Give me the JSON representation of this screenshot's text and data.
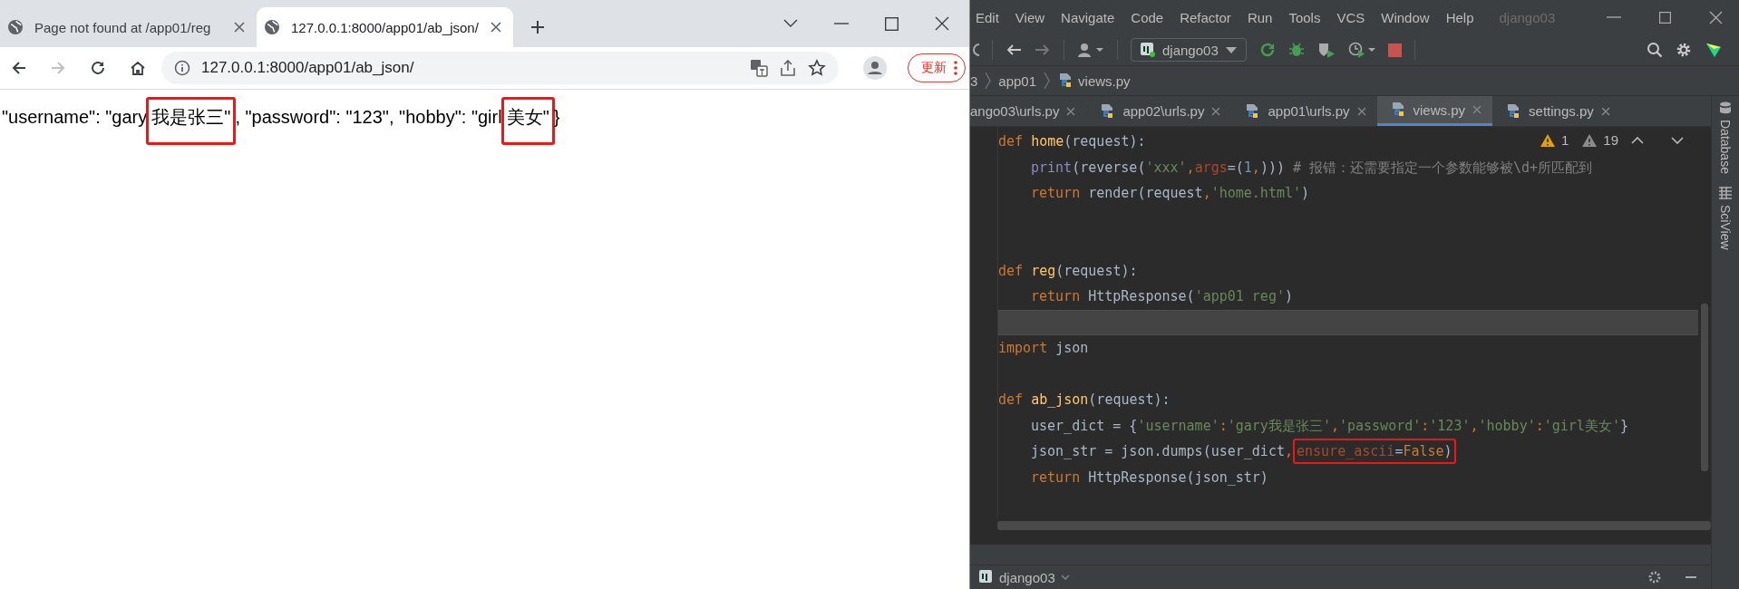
{
  "browser": {
    "tabs": [
      {
        "title": "Page not found at /app01/reg",
        "selected": false
      },
      {
        "title": "127.0.0.1:8000/app01/ab_json/",
        "selected": true
      }
    ],
    "address": "127.0.0.1:8000/app01/ab_json/",
    "update_button": "更新",
    "body": [
      {
        "kind": "plain",
        "text": "\"username\": \"gary"
      },
      {
        "kind": "annotated",
        "text": "我是张三\""
      },
      {
        "kind": "plain",
        "text": ", \"password\": \"123\", \"hobby\": \"girl"
      },
      {
        "kind": "annotated",
        "text": "美女\""
      },
      {
        "kind": "plain",
        "text": "}"
      }
    ]
  },
  "ide": {
    "menu": [
      "Edit",
      "View",
      "Navigate",
      "Code",
      "Refactor",
      "Run",
      "Tools",
      "VCS",
      "Window",
      "Help"
    ],
    "project_title": "django03",
    "run_config": "django03",
    "breadcrumb": [
      "3",
      "app01",
      "views.py"
    ],
    "tabs": [
      {
        "title": "ango03\\urls.py",
        "selected": false
      },
      {
        "title": "app02\\urls.py",
        "selected": false
      },
      {
        "title": "app01\\urls.py",
        "selected": false
      },
      {
        "title": "views.py",
        "selected": true
      },
      {
        "title": "settings.py",
        "selected": false
      }
    ],
    "warnings": [
      {
        "kind": "warning",
        "count": "1"
      },
      {
        "kind": "weak",
        "count": "19"
      }
    ],
    "lines": [
      {
        "kind": "code",
        "indent": false,
        "current": false,
        "tokens": [
          {
            "kind": "kw",
            "text": "def "
          },
          {
            "kind": "fn",
            "text": "home"
          },
          {
            "kind": "plain",
            "text": "(request):"
          }
        ]
      },
      {
        "kind": "code",
        "indent": true,
        "current": false,
        "tokens": [
          {
            "kind": "builtin",
            "text": "print"
          },
          {
            "kind": "plain",
            "text": "(reverse("
          },
          {
            "kind": "str",
            "text": "'xxx'"
          },
          {
            "kind": "kw",
            "text": ","
          },
          {
            "kind": "kwarg",
            "text": "args"
          },
          {
            "kind": "plain",
            "text": "=("
          },
          {
            "kind": "num",
            "text": "1"
          },
          {
            "kind": "kw",
            "text": ","
          },
          {
            "kind": "plain",
            "text": ")))  "
          },
          {
            "kind": "comment",
            "text": "# 报错：还需要指定一个参数能够被\\d+所匹配到"
          }
        ]
      },
      {
        "kind": "code",
        "indent": true,
        "current": false,
        "tokens": [
          {
            "kind": "kw",
            "text": "return "
          },
          {
            "kind": "plain",
            "text": "render(request"
          },
          {
            "kind": "kw",
            "text": ","
          },
          {
            "kind": "str",
            "text": "'home.html'"
          },
          {
            "kind": "plain",
            "text": ")"
          }
        ]
      },
      {
        "kind": "blank",
        "current": false
      },
      {
        "kind": "blank",
        "current": false
      },
      {
        "kind": "code",
        "indent": false,
        "current": false,
        "tokens": [
          {
            "kind": "kw",
            "text": "def "
          },
          {
            "kind": "fn",
            "text": "reg"
          },
          {
            "kind": "plain",
            "text": "(request):"
          }
        ]
      },
      {
        "kind": "code",
        "indent": true,
        "current": false,
        "tokens": [
          {
            "kind": "kw",
            "text": "return "
          },
          {
            "kind": "plain",
            "text": "HttpResponse("
          },
          {
            "kind": "str",
            "text": "'app01 reg'"
          },
          {
            "kind": "plain",
            "text": ")"
          }
        ]
      },
      {
        "kind": "blank",
        "current": true
      },
      {
        "kind": "code",
        "indent": false,
        "current": false,
        "tokens": [
          {
            "kind": "kw",
            "text": "import "
          },
          {
            "kind": "plain",
            "text": "json"
          }
        ]
      },
      {
        "kind": "blank",
        "current": false
      },
      {
        "kind": "code",
        "indent": false,
        "current": false,
        "tokens": [
          {
            "kind": "kw",
            "text": "def "
          },
          {
            "kind": "fn",
            "text": "ab_json"
          },
          {
            "kind": "plain",
            "text": "(request):"
          }
        ]
      },
      {
        "kind": "code",
        "indent": true,
        "current": false,
        "tokens": [
          {
            "kind": "plain",
            "text": "user_dict = {"
          },
          {
            "kind": "str",
            "text": "'username'"
          },
          {
            "kind": "kw",
            "text": ":"
          },
          {
            "kind": "str",
            "text": "'gary我是张三'"
          },
          {
            "kind": "kw",
            "text": ","
          },
          {
            "kind": "str",
            "text": "'password'"
          },
          {
            "kind": "kw",
            "text": ":"
          },
          {
            "kind": "str",
            "text": "'123'"
          },
          {
            "kind": "kw",
            "text": ","
          },
          {
            "kind": "str",
            "text": "'hobby'"
          },
          {
            "kind": "kw",
            "text": ":"
          },
          {
            "kind": "str",
            "text": "'girl美女'"
          },
          {
            "kind": "plain",
            "text": "}"
          }
        ]
      },
      {
        "kind": "code",
        "indent": true,
        "current": false,
        "tokens": [
          {
            "kind": "plain",
            "text": "json_str = json.dumps(user_dict"
          },
          {
            "kind": "kw",
            "text": ","
          },
          {
            "kind": "annotated",
            "tokens": [
              {
                "kind": "kwarg",
                "text": "ensure_ascii"
              },
              {
                "kind": "plain",
                "text": "="
              },
              {
                "kind": "kw",
                "text": "False"
              },
              {
                "kind": "plain",
                "text": ")"
              }
            ]
          }
        ]
      },
      {
        "kind": "code",
        "indent": true,
        "current": false,
        "tokens": [
          {
            "kind": "kw",
            "text": "return "
          },
          {
            "kind": "plain",
            "text": "HttpResponse(json_str)"
          }
        ]
      }
    ],
    "side_tools": [
      "Database",
      "SciView"
    ],
    "bottom_tool": "django03"
  }
}
